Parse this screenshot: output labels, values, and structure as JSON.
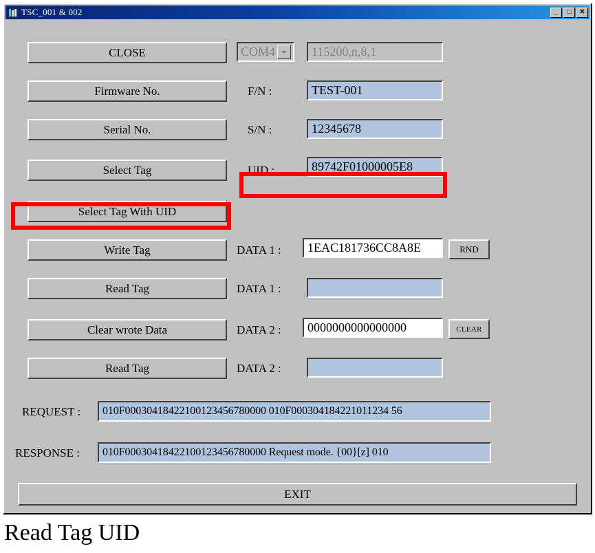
{
  "window": {
    "title": "TSC_001 & 002",
    "icon": "app-icon",
    "controls": {
      "minimize": "_",
      "maximize": "□",
      "close": "✕"
    }
  },
  "form": {
    "rows": [
      {
        "button": "CLOSE",
        "label": "",
        "combo_value": "COM4",
        "port_settings": "115200,n,8,1"
      },
      {
        "button": "Firmware No.",
        "label": "F/N :",
        "value": "TEST-001"
      },
      {
        "button": "Serial No.",
        "label": "S/N :",
        "value": "12345678"
      },
      {
        "button": "Select Tag",
        "label": "UID :",
        "value": "89742F01000005E8"
      },
      {
        "button": "Select Tag With UID",
        "label": "",
        "value": ""
      },
      {
        "button": "Write Tag",
        "label": "DATA 1 :",
        "value": "1EAC181736CC8A8E",
        "side_button": "RND"
      },
      {
        "button": "Read Tag",
        "label": "DATA 1 :",
        "value": ""
      },
      {
        "button": "Clear wrote Data",
        "label": "DATA 2 :",
        "value": "0000000000000000",
        "side_button": "CLEAR"
      },
      {
        "button": "Read Tag",
        "label": "DATA 2 :",
        "value": ""
      }
    ],
    "log": {
      "request_label": "REQUEST :",
      "request_value": "010F00030418422100123456780000   010F000304184221011234 56",
      "response_label": "RESPONSE :",
      "response_value": "010F00030418422100123456780000   Request mode.  {00}[z]     010"
    },
    "exit_button": "EXIT"
  },
  "caption": "Read Tag UID",
  "annotations": {
    "accent_color": "#ff0000",
    "boxes": [
      {
        "name": "uid-field-highlight"
      },
      {
        "name": "select-tag-with-uid-highlight"
      }
    ]
  }
}
